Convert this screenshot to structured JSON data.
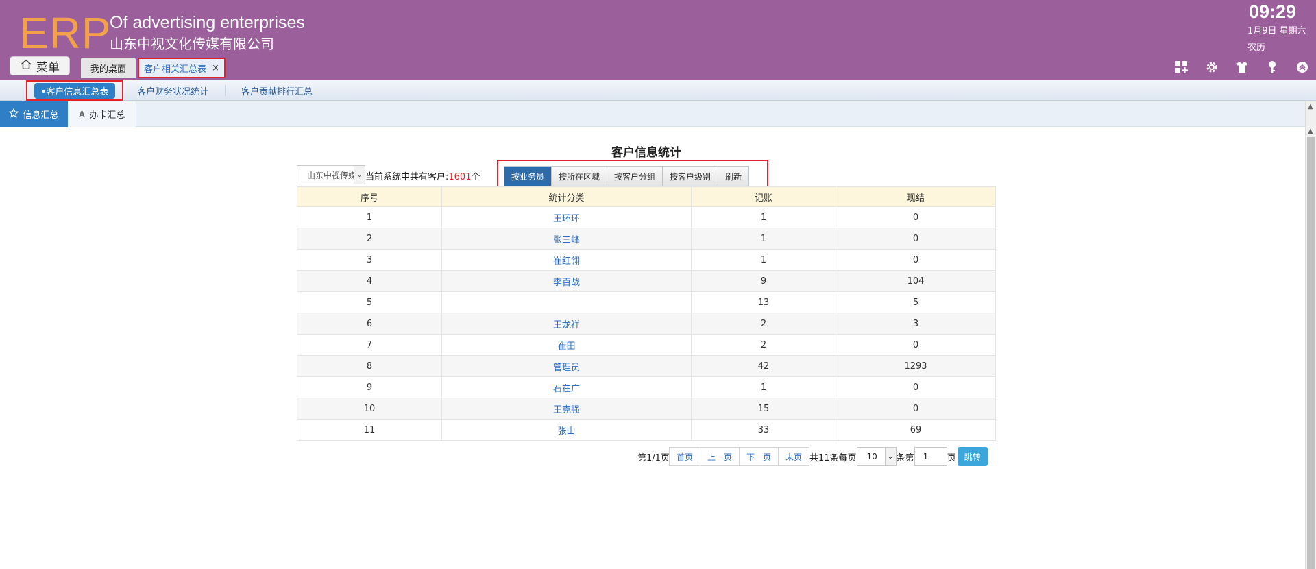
{
  "header": {
    "logo": "ERP",
    "tagline": "Of advertising enterprises",
    "company": "山东中视文化传媒有限公司",
    "menu_label": "菜单",
    "time": "09:29",
    "date": "1月9日 星期六",
    "lunar": "农历",
    "tabs": [
      {
        "label": "我的桌面"
      },
      {
        "label": "客户相关汇总表",
        "close": "×"
      }
    ],
    "tool_icons": [
      "grid-add-icon",
      "gear-icon",
      "shirt-icon",
      "key-icon",
      "collapse-up-icon"
    ]
  },
  "subnav": {
    "items": [
      {
        "label": "•客户信息汇总表"
      },
      {
        "label": "客户财务状况统计"
      },
      {
        "label": "客户贡献排行汇总"
      }
    ]
  },
  "thirdnav": {
    "items": [
      {
        "label": "信息汇总",
        "icon": "star-icon"
      },
      {
        "label": "办卡汇总",
        "icon": "letter-a-icon"
      }
    ]
  },
  "main": {
    "title": "客户信息统计",
    "dept_select": "山东中视传媒",
    "count_prefix": "当前系统中共有客户:",
    "count_value": "1601",
    "count_suffix": "个",
    "buttons": [
      {
        "label": "按业务员"
      },
      {
        "label": "按所在区域"
      },
      {
        "label": "按客户分组"
      },
      {
        "label": "按客户级别"
      },
      {
        "label": "刷新"
      }
    ],
    "table": {
      "headers": [
        "序号",
        "统计分类",
        "记账",
        "现结"
      ],
      "rows": [
        [
          "1",
          "王环环",
          "1",
          "0"
        ],
        [
          "2",
          "张三峰",
          "1",
          "0"
        ],
        [
          "3",
          "崔红翎",
          "1",
          "0"
        ],
        [
          "4",
          "李百战",
          "9",
          "104"
        ],
        [
          "5",
          "",
          "13",
          "5"
        ],
        [
          "6",
          "王龙祥",
          "2",
          "3"
        ],
        [
          "7",
          "崔田",
          "2",
          "0"
        ],
        [
          "8",
          "管理员",
          "42",
          "1293"
        ],
        [
          "9",
          "石在广",
          "1",
          "0"
        ],
        [
          "10",
          "王克强",
          "15",
          "0"
        ],
        [
          "11",
          "张山",
          "33",
          "69"
        ]
      ]
    }
  },
  "pager": {
    "page_info": "第1/1页",
    "first": "首页",
    "prev": "上一页",
    "next": "下一页",
    "last": "末页",
    "total": "共11条每页",
    "per_page": "10",
    "per_suffix": "条第",
    "page_input": "1",
    "page_suffix": "页",
    "go": "跳转"
  },
  "colors": {
    "header_bg": "#9b5f9c",
    "logo": "#f4a24a",
    "accent_blue": "#2e7fc6",
    "highlight_red": "#e0252a"
  }
}
